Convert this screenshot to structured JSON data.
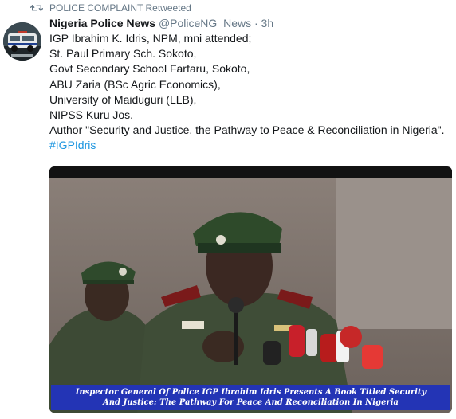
{
  "retweet": {
    "label": "POLICE COMPLAINT Retweeted",
    "icon": "retweet-icon"
  },
  "tweet": {
    "author_name": "Nigeria Police News",
    "handle": "@PoliceNG_News",
    "separator": "·",
    "time": "3h",
    "lines": [
      "IGP Ibrahim K. Idris, NPM, mni attended;",
      "St. Paul Primary Sch. Sokoto,",
      "Govt Secondary School Farfaru, Sokoto,",
      "ABU Zaria (BSc Agric Economics),",
      "University of Maiduguri (LLB),",
      "NIPSS Kuru Jos.",
      "Author \"Security and Justice, the Pathway to Peace & Reconciliation in Nigeria\"."
    ],
    "hashtag": "#IGPIdris"
  },
  "media": {
    "caption_line1": "Inspector General Of Police IGP Ibrahim Idris Presents A Book Titled Security",
    "caption_line2": "And Justice: The Pathway For Peace And Reconciliation In Nigeria"
  },
  "colors": {
    "link": "#1b95e0",
    "muted": "#657786",
    "caption_band": "#2334b5"
  }
}
